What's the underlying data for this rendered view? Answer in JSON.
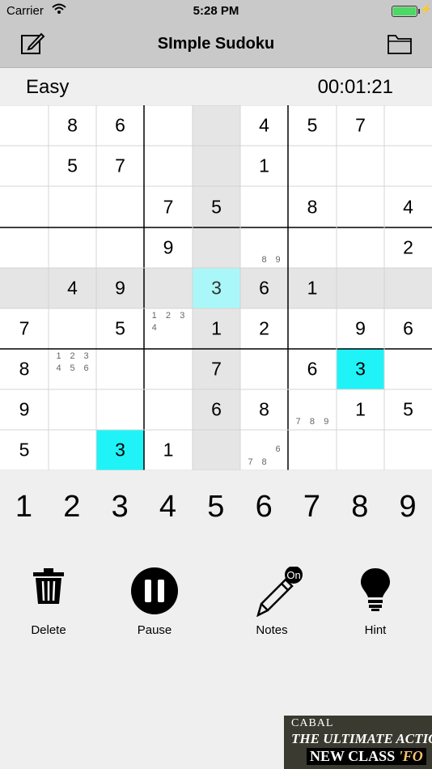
{
  "status_bar": {
    "carrier": "Carrier",
    "time": "5:28 PM",
    "battery_color": "#4cd964"
  },
  "nav": {
    "title": "SImple Sudoku",
    "left_icon": "edit-icon",
    "right_icon": "folder-icon"
  },
  "game": {
    "difficulty": "Easy",
    "timer": "00:01:21"
  },
  "board": {
    "selected": [
      4,
      4
    ],
    "same_value_cells": [
      [
        4,
        4
      ],
      [
        6,
        7
      ],
      [
        8,
        2
      ]
    ],
    "cells": [
      [
        {
          "v": ""
        },
        {
          "v": "8"
        },
        {
          "v": "6"
        },
        {
          "v": ""
        },
        {
          "v": ""
        },
        {
          "v": "4"
        },
        {
          "v": "5"
        },
        {
          "v": "7"
        },
        {
          "v": ""
        }
      ],
      [
        {
          "v": ""
        },
        {
          "v": "5"
        },
        {
          "v": "7"
        },
        {
          "v": ""
        },
        {
          "v": ""
        },
        {
          "v": "1"
        },
        {
          "v": ""
        },
        {
          "v": ""
        },
        {
          "v": ""
        }
      ],
      [
        {
          "v": ""
        },
        {
          "v": ""
        },
        {
          "v": ""
        },
        {
          "v": "7"
        },
        {
          "v": "5"
        },
        {
          "v": ""
        },
        {
          "v": "8"
        },
        {
          "v": ""
        },
        {
          "v": "4"
        }
      ],
      [
        {
          "v": ""
        },
        {
          "v": ""
        },
        {
          "v": ""
        },
        {
          "v": "9"
        },
        {
          "v": ""
        },
        {
          "v": "",
          "n": [
            "8",
            "9"
          ]
        },
        {
          "v": ""
        },
        {
          "v": ""
        },
        {
          "v": "2"
        }
      ],
      [
        {
          "v": ""
        },
        {
          "v": "4"
        },
        {
          "v": "9"
        },
        {
          "v": ""
        },
        {
          "v": "3"
        },
        {
          "v": "6"
        },
        {
          "v": "1"
        },
        {
          "v": ""
        },
        {
          "v": ""
        }
      ],
      [
        {
          "v": "7"
        },
        {
          "v": ""
        },
        {
          "v": "5"
        },
        {
          "v": "",
          "n": [
            "1",
            "2",
            "3",
            "4"
          ]
        },
        {
          "v": "1"
        },
        {
          "v": "2"
        },
        {
          "v": ""
        },
        {
          "v": "9"
        },
        {
          "v": "6"
        }
      ],
      [
        {
          "v": "8"
        },
        {
          "v": "",
          "n": [
            "1",
            "2",
            "3",
            "4",
            "5",
            "6"
          ]
        },
        {
          "v": ""
        },
        {
          "v": ""
        },
        {
          "v": "7"
        },
        {
          "v": ""
        },
        {
          "v": "6"
        },
        {
          "v": "3"
        },
        {
          "v": ""
        }
      ],
      [
        {
          "v": "9"
        },
        {
          "v": ""
        },
        {
          "v": ""
        },
        {
          "v": ""
        },
        {
          "v": "6"
        },
        {
          "v": "8"
        },
        {
          "v": "",
          "n": [
            "7",
            "8",
            "9"
          ]
        },
        {
          "v": "1"
        },
        {
          "v": "5"
        }
      ],
      [
        {
          "v": "5"
        },
        {
          "v": ""
        },
        {
          "v": "3"
        },
        {
          "v": "1"
        },
        {
          "v": ""
        },
        {
          "v": "",
          "n": [
            "6",
            "7",
            "8"
          ]
        },
        {
          "v": ""
        },
        {
          "v": ""
        },
        {
          "v": ""
        }
      ]
    ]
  },
  "number_pad": [
    "1",
    "2",
    "3",
    "4",
    "5",
    "6",
    "7",
    "8",
    "9"
  ],
  "actions": {
    "delete": {
      "label": "Delete",
      "icon": "trash-icon"
    },
    "pause": {
      "label": "Pause",
      "icon": "pause-icon"
    },
    "notes": {
      "label": "Notes",
      "icon": "pencil-icon",
      "badge": "On"
    },
    "hint": {
      "label": "Hint",
      "icon": "lightbulb-icon"
    }
  },
  "ad": {
    "line1": "CABAL",
    "line2": "THE ULTIMATE ACTION",
    "line3_prefix": "NEW CLASS ",
    "line3_accent": "'FO"
  },
  "colors": {
    "bar": "#c9c9c9",
    "background": "#efefef",
    "highlight": "#e5e5e5",
    "selected": "#aaf7f9",
    "same_value": "#1ff3f7"
  }
}
